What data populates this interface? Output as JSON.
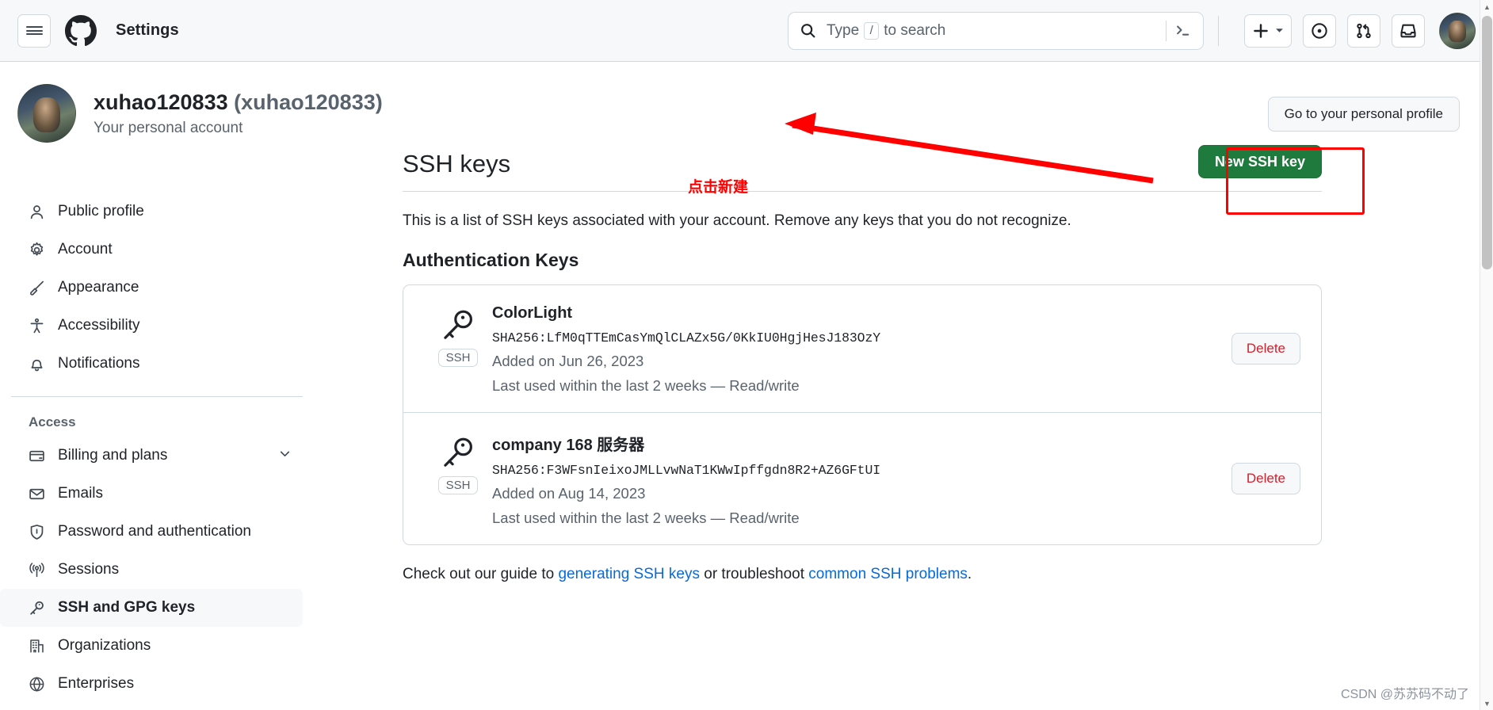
{
  "header": {
    "menu_label": "Menu",
    "logo_name": "github-logo",
    "title": "Settings",
    "search": {
      "placeholder_prefix": "Type",
      "slash_key": "/",
      "placeholder_suffix": "to search",
      "command_palette_icon": "terminal-icon"
    },
    "actions": [
      {
        "name": "create-new-button",
        "icon": "plus-icon",
        "has_caret": true
      },
      {
        "name": "issues-button",
        "icon": "issue-opened-icon",
        "has_caret": false
      },
      {
        "name": "pull-requests-button",
        "icon": "git-pull-request-icon",
        "has_caret": false
      },
      {
        "name": "notifications-inbox-button",
        "icon": "inbox-icon",
        "has_caret": false
      }
    ],
    "avatar_name": "user-avatar"
  },
  "profile": {
    "username": "xuhao120833",
    "handle": "(xuhao120833)",
    "subtitle": "Your personal account",
    "go_personal_label": "Go to your personal profile"
  },
  "sidebar": {
    "primary": [
      {
        "label": "Public profile",
        "icon": "person-icon",
        "selected": false,
        "chevron": false
      },
      {
        "label": "Account",
        "icon": "gear-icon",
        "selected": false,
        "chevron": false
      },
      {
        "label": "Appearance",
        "icon": "paintbrush-icon",
        "selected": false,
        "chevron": false
      },
      {
        "label": "Accessibility",
        "icon": "accessibility-icon",
        "selected": false,
        "chevron": false
      },
      {
        "label": "Notifications",
        "icon": "bell-icon",
        "selected": false,
        "chevron": false
      }
    ],
    "group_title": "Access",
    "access": [
      {
        "label": "Billing and plans",
        "icon": "credit-card-icon",
        "selected": false,
        "chevron": true
      },
      {
        "label": "Emails",
        "icon": "mail-icon",
        "selected": false,
        "chevron": false
      },
      {
        "label": "Password and authentication",
        "icon": "shield-lock-icon",
        "selected": false,
        "chevron": false
      },
      {
        "label": "Sessions",
        "icon": "broadcast-icon",
        "selected": false,
        "chevron": false
      },
      {
        "label": "SSH and GPG keys",
        "icon": "key-icon",
        "selected": true,
        "chevron": false
      },
      {
        "label": "Organizations",
        "icon": "organization-icon",
        "selected": false,
        "chevron": false
      },
      {
        "label": "Enterprises",
        "icon": "globe-icon",
        "selected": false,
        "chevron": false
      }
    ]
  },
  "main": {
    "title": "SSH keys",
    "new_key_button": "New SSH key",
    "description": "This is a list of SSH keys associated with your account. Remove any keys that you do not recognize.",
    "section_title": "Authentication Keys",
    "keys": [
      {
        "name": "ColorLight",
        "fingerprint": "SHA256:LfM0qTTEmCasYmQlCLAZx5G/0KkIU0HgjHesJ183OzY",
        "added": "Added on Jun 26, 2023",
        "last_used": "Last used within the last 2 weeks — Read/write",
        "badge": "SSH",
        "delete_label": "Delete"
      },
      {
        "name": "company 168 服务器",
        "fingerprint": "SHA256:F3WFsnIeixoJMLLvwNaT1KWwIpffgdn8R2+AZ6GFtUI",
        "added": "Added on Aug 14, 2023",
        "last_used": "Last used within the last 2 weeks — Read/write",
        "badge": "SSH",
        "delete_label": "Delete"
      }
    ],
    "footer": {
      "lead": "Check out our guide to ",
      "link1": "generating SSH keys",
      "middle": " or troubleshoot ",
      "link2": "common SSH problems",
      "end": "."
    }
  },
  "annotation": {
    "text": "点击新建",
    "color": "#ff0000"
  },
  "watermark": "CSDN @苏苏码不动了",
  "colors": {
    "accent": "#0969da",
    "success": "#1f7a3d",
    "danger": "#cf222e",
    "border": "#d1d9e0",
    "muted": "#59636e",
    "annotation": "#ff0000"
  }
}
